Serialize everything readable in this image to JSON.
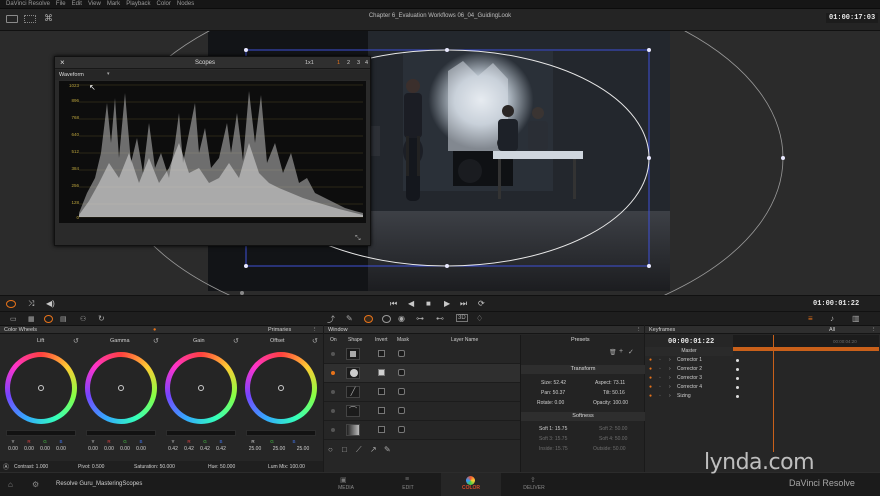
{
  "menubar": {
    "items": [
      "DaVinci Resolve",
      "File",
      "Edit",
      "View",
      "Mark",
      "Playback",
      "Color",
      "Nodes"
    ],
    "project_title": "Chapter 6_Evaluation Workflows 06_04_GuidingLook",
    "timecode": "01:00:17:03"
  },
  "scopes": {
    "title": "Scopes",
    "layout": "1x1",
    "pages": [
      "1",
      "2",
      "3",
      "4"
    ],
    "scope_type": "Waveform",
    "scale": [
      "1023",
      "896",
      "768",
      "640",
      "512",
      "384",
      "256",
      "128",
      "0"
    ]
  },
  "transport": {
    "timecode": "01:00:01:22"
  },
  "color_wheels": {
    "title": "Color Wheels",
    "mode": "Primaries",
    "wheels": [
      {
        "name": "Lift",
        "y": "0.00",
        "r": "0.00",
        "g": "0.00",
        "b": "0.00"
      },
      {
        "name": "Gamma",
        "y": "0.00",
        "r": "0.00",
        "g": "0.00",
        "b": "0.00"
      },
      {
        "name": "Gain",
        "y": "0.42",
        "r": "0.42",
        "g": "0.42",
        "b": "0.42"
      },
      {
        "name": "Offset",
        "y": "25.00",
        "r": "25.00",
        "g": "25.00",
        "b": "25.00"
      }
    ],
    "channel_labels": {
      "y": "Y",
      "r": "R",
      "g": "G",
      "b": "B"
    },
    "footer": {
      "contrast": "Contrast: 1.000",
      "pivot": "Pivot: 0.500",
      "saturation": "Saturation: 50.000",
      "hue": "Hue: 50.000",
      "lum_mix": "Lum Mix: 100.00"
    }
  },
  "window_panel": {
    "title": "Window",
    "columns": [
      "On",
      "Shape",
      "Invert",
      "Mask",
      "Layer Name"
    ],
    "presets": "Presets",
    "transform_title": "Transform",
    "transform": [
      {
        "label": "Size: 52.42",
        "dim": false
      },
      {
        "label": "Aspect: 73.11",
        "dim": false
      },
      {
        "label": "Pan: 50.37",
        "dim": false
      },
      {
        "label": "Tilt: 50.16",
        "dim": false
      },
      {
        "label": "Rotate: 0.00",
        "dim": false
      },
      {
        "label": "Opacity: 100.00",
        "dim": false
      }
    ],
    "softness_title": "Softness",
    "softness": [
      {
        "label": "Soft 1: 15.75",
        "dim": false
      },
      {
        "label": "Soft 2: 50.00",
        "dim": true
      },
      {
        "label": "Soft 3: 15.75",
        "dim": true
      },
      {
        "label": "Soft 4: 50.00",
        "dim": true
      },
      {
        "label": "Inside: 15.75",
        "dim": true
      },
      {
        "label": "Outside: 50.00",
        "dim": true
      }
    ]
  },
  "keyframes": {
    "title": "Keyframes",
    "filter": "All",
    "timecode": "00:00:01:22",
    "ruler_tc": "00:00:04:20",
    "tracks": [
      "Master",
      "Corrector 1",
      "Corrector 2",
      "Corrector 3",
      "Corrector 4",
      "Sizing"
    ]
  },
  "bottombar": {
    "project": "Resolve Guru_MasteringScopes",
    "tabs": [
      "MEDIA",
      "EDIT",
      "COLOR",
      "DELIVER"
    ],
    "active_tab": "COLOR",
    "watermark": "lynda.com",
    "app_name": "DaVinci Resolve"
  },
  "colors": {
    "accent_orange": "#e8731a",
    "active_color_tab": "#d24a2a",
    "window_outline": "#3d4fd6"
  }
}
